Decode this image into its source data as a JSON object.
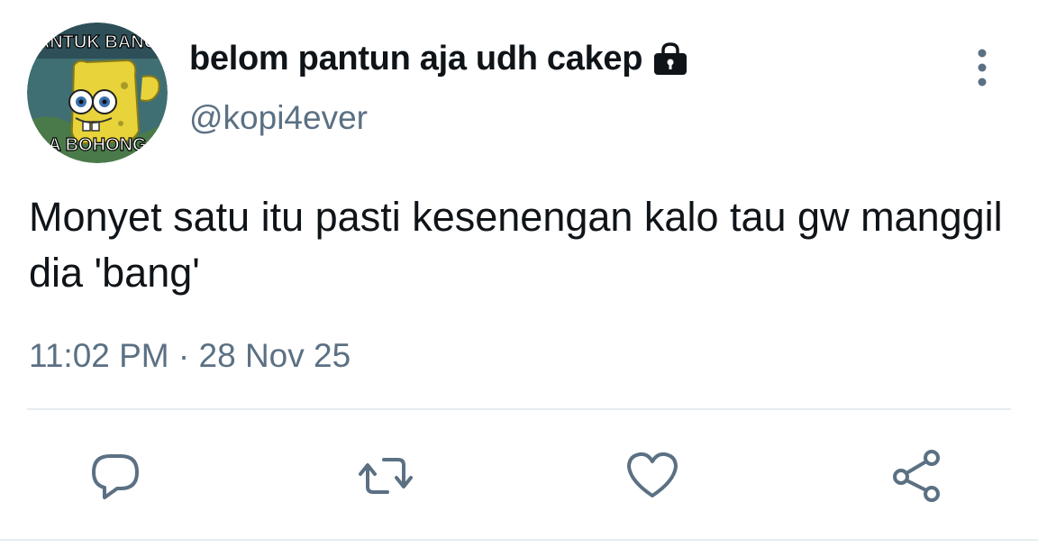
{
  "tweet": {
    "display_name": "belom pantun aja udh cakep",
    "handle": "@kopi4ever",
    "text": "Monyet satu itu pasti kesenengan kalo tau gw manggil dia 'bang'",
    "timestamp": "11:02 PM · 28 Nov 25",
    "avatar": {
      "top_text": "ANTUK BANG",
      "bottom_text": "A BOHONG"
    },
    "protected": true
  },
  "icons": {
    "lock": "lock-icon",
    "more": "more-vertical-icon",
    "reply": "reply-icon",
    "retweet": "retweet-icon",
    "like": "heart-icon",
    "share": "share-icon"
  },
  "colors": {
    "text_primary": "#0f1419",
    "text_secondary": "#5b7083",
    "icon": "#5b7083",
    "divider": "#e6ecf0"
  }
}
